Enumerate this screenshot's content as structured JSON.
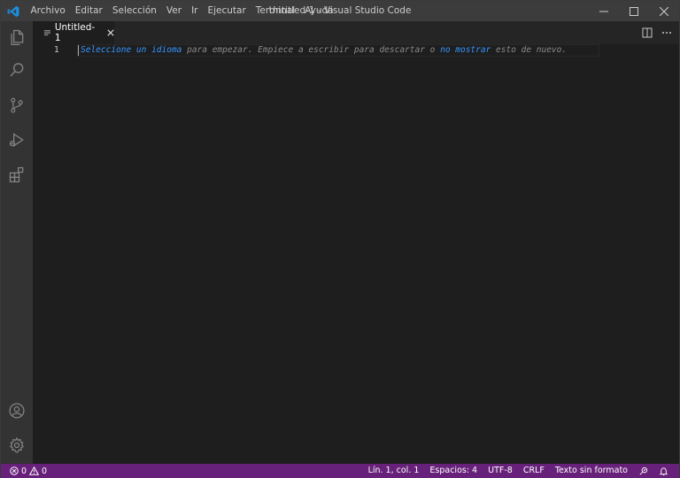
{
  "titlebar": {
    "menu": [
      "Archivo",
      "Editar",
      "Selección",
      "Ver",
      "Ir",
      "Ejecutar",
      "Terminal",
      "Ayuda"
    ],
    "window_title": "Untitled-1 - Visual Studio Code"
  },
  "activitybar": {
    "top_icons": [
      "explorer-icon",
      "search-icon",
      "source-control-icon",
      "run-debug-icon",
      "extensions-icon"
    ],
    "bottom_icons": [
      "account-icon",
      "gear-icon"
    ]
  },
  "tabs": [
    {
      "label": "Untitled-1",
      "active": true
    }
  ],
  "editor": {
    "line_number": "1",
    "hint": {
      "link1": "Seleccione un idioma",
      "text1": " para empezar. Empiece a escribir para descartar o ",
      "link2": "no mostrar",
      "text2": " esto de nuevo."
    }
  },
  "statusbar": {
    "errors": "0",
    "warnings": "0",
    "position": "Lín. 1, col. 1",
    "spaces": "Espacios: 4",
    "encoding": "UTF-8",
    "eol": "CRLF",
    "language": "Texto sin formato"
  },
  "colors": {
    "statusbar": "#68217a",
    "titlebar": "#3c3c3c",
    "activitybar": "#333333",
    "editor": "#1e1e1e",
    "link": "#3794ff",
    "logo": "#1c8fe0"
  }
}
